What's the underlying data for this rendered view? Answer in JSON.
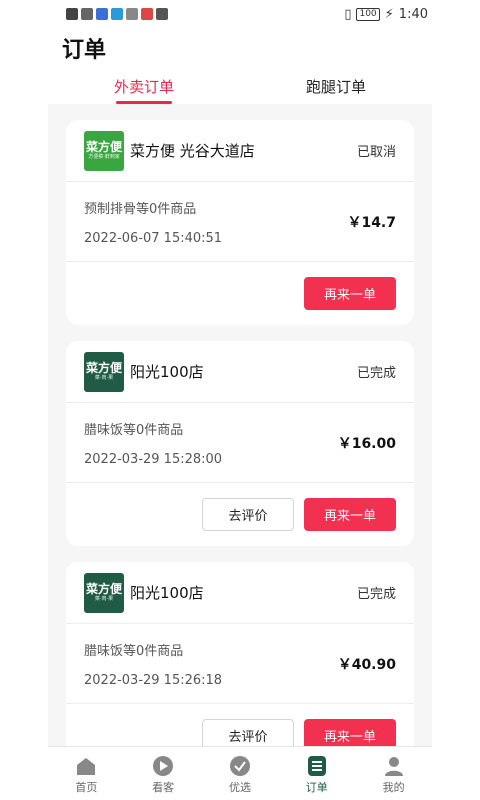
{
  "status_bar": {
    "time": "1:40",
    "battery": "100"
  },
  "header": {
    "title": "订单",
    "tabs": [
      {
        "label": "外卖订单",
        "active": true
      },
      {
        "label": "跑腿订单",
        "active": false
      }
    ]
  },
  "orders": [
    {
      "logo_text": "菜方便",
      "logo_sub": "方便菜·鲜到家",
      "store": "菜方便 光谷大道店",
      "status": "已取消",
      "items": "预制排骨等0件商品",
      "time": "2022-06-07 15:40:51",
      "price": "￥14.7",
      "buttons": {
        "again": "再来一单"
      }
    },
    {
      "logo_text": "菜方便",
      "logo_sub": "菜·肉·果",
      "store": "阳光100店",
      "status": "已完成",
      "items": "腊味饭等0件商品",
      "time": "2022-03-29 15:28:00",
      "price": "￥16.00",
      "buttons": {
        "review": "去评价",
        "again": "再来一单"
      }
    },
    {
      "logo_text": "菜方便",
      "logo_sub": "菜·肉·果",
      "store": "阳光100店",
      "status": "已完成",
      "items": "腊味饭等0件商品",
      "time": "2022-03-29 15:26:18",
      "price": "￥40.90",
      "buttons": {
        "review": "去评价",
        "again": "再来一单"
      }
    }
  ],
  "tabbar": [
    {
      "label": "首页",
      "icon": "home-icon",
      "active": false
    },
    {
      "label": "看客",
      "icon": "play-icon",
      "active": false
    },
    {
      "label": "优选",
      "icon": "check-icon",
      "active": false
    },
    {
      "label": "订单",
      "icon": "list-icon",
      "active": true
    },
    {
      "label": "我的",
      "icon": "user-icon",
      "active": false
    }
  ],
  "colors": {
    "accent_red": "#f2304f",
    "tab_active": "#e8294b",
    "brand_green": "#1f5b45"
  }
}
